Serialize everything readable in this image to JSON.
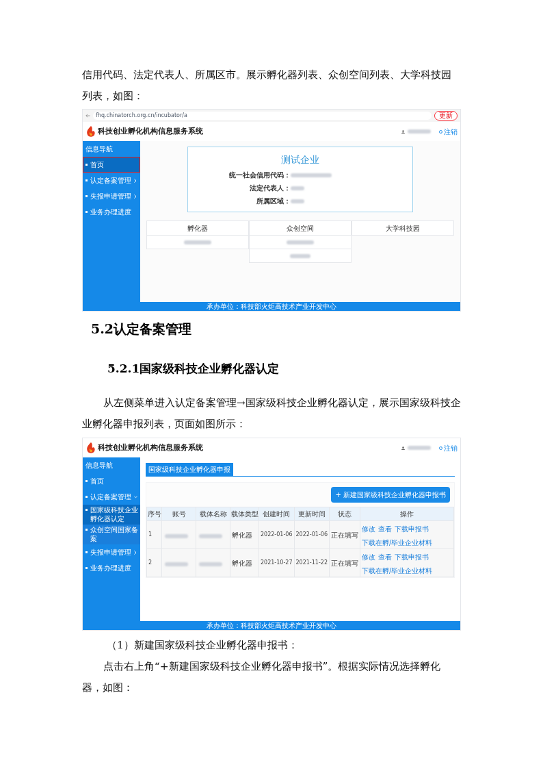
{
  "intro_paragraph": "信用代码、法定代表人、所属区市。展示孵化器列表、众创空间列表、大学科技园列表，如图：",
  "screenshot_1": {
    "browser": {
      "url": "fhq.chinatorch.org.cn/incubator/a",
      "update_button": "更新"
    },
    "app": {
      "title": "科技创业孵化机构信息服务系统",
      "logout": "注销",
      "sidebar": {
        "heading": "信息导航",
        "items": [
          {
            "label": "首页",
            "selected": true,
            "annotated": true
          },
          {
            "label": "认定备案管理",
            "selected": false,
            "annotated": false,
            "expanded": false
          },
          {
            "label": "失报申请管理",
            "selected": false,
            "annotated": false,
            "expanded": false
          },
          {
            "label": "业务办理进度",
            "selected": false,
            "annotated": false
          }
        ]
      },
      "company": {
        "name": "测试企业",
        "fields": [
          {
            "label": "统一社会信用代码："
          },
          {
            "label": "法定代表人："
          },
          {
            "label": "所属区域："
          }
        ]
      },
      "lists": [
        {
          "heading": "孵化器",
          "entries": [
            {
              "redacted": true
            }
          ]
        },
        {
          "heading": "众创空间",
          "entries": [
            {
              "redacted": true
            },
            {
              "redacted": true
            }
          ]
        },
        {
          "heading": "大学科技园"
        }
      ],
      "footer": "承办单位：科技部火炬高技术产业开发中心"
    }
  },
  "heading_1": "5.2认定备案管理",
  "heading_2": "5.2.1国家级科技企业孵化器认定",
  "paragraph_2": "从左侧菜单进入认定备案管理→国家级科技企业孵化器认定，展示国家级科技企业孵化器申报列表，页面如图所示：",
  "screenshot_2": {
    "app": {
      "title": "科技创业孵化机构信息服务系统",
      "logout": "注销",
      "sidebar": {
        "heading": "信息导航",
        "items": [
          {
            "label": "首页",
            "selected": false,
            "annotated": false
          },
          {
            "label": "认定备案管理",
            "selected": false,
            "annotated": false,
            "expanded": true,
            "children": [
              {
                "label": "国家级科技企业孵化器认定",
                "selected": true
              },
              {
                "label": "众创空间国家备案",
                "selected": false
              }
            ]
          },
          {
            "label": "失报申请管理",
            "selected": false,
            "annotated": false,
            "expanded": false
          },
          {
            "label": "业务办理进度",
            "selected": false,
            "annotated": false
          }
        ]
      },
      "tab": "国家级科技企业孵化器申报",
      "new_button": "+ 新建国家级科技企业孵化器申报书",
      "table": {
        "columns": [
          "序号",
          "账号",
          "载体名称",
          "载体类型",
          "创建时间",
          "更新时间",
          "状态",
          "操作"
        ],
        "rows": [
          {
            "index": "1",
            "type": "孵化器",
            "created": "2022-01-06",
            "updated": "2022-01-06",
            "status": "正在填写",
            "actions": [
              "修改",
              "查看",
              "下载申报书",
              "下载在孵/毕业企业材料"
            ]
          },
          {
            "index": "2",
            "type": "孵化器",
            "created": "2021-10-27",
            "updated": "2021-11-22",
            "status": "正在填写",
            "actions": [
              "修改",
              "查看",
              "下载申报书",
              "下载在孵/毕业企业材料"
            ]
          }
        ]
      },
      "footer": "承办单位：科技部火炬高技术产业开发中心"
    }
  },
  "step_label": "（1）新建国家级科技企业孵化器申报书：",
  "paragraph_3": "点击右上角“+新建国家级科技企业孵化器申报书”。根据实际情况选择孵化器，如图："
}
